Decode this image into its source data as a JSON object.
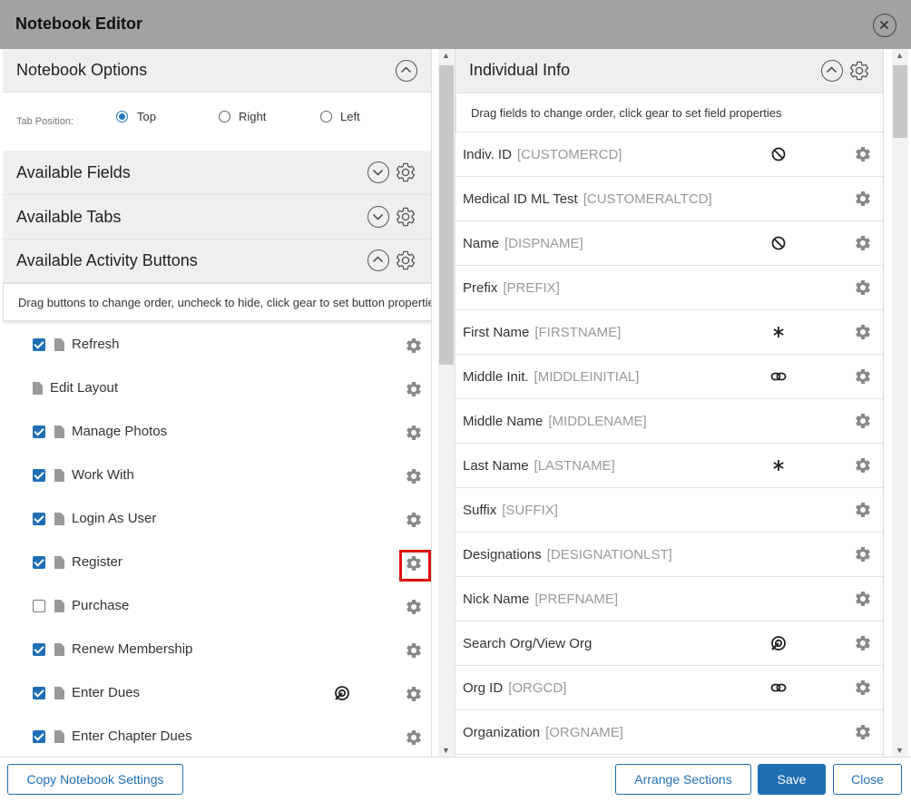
{
  "dialog": {
    "title": "Notebook Editor"
  },
  "left": {
    "notebook_options": {
      "label": "Notebook Options"
    },
    "tab_position": {
      "label": "Tab Position:",
      "options": [
        "Top",
        "Right",
        "Left"
      ],
      "selected": "Top"
    },
    "available_fields": {
      "label": "Available Fields"
    },
    "available_tabs": {
      "label": "Available Tabs"
    },
    "available_activity_buttons": {
      "label": "Available Activity Buttons",
      "hint": "Drag buttons to change order, uncheck to hide, click gear to set button properties",
      "items": [
        {
          "label": "Refresh",
          "checked": true
        },
        {
          "label": "Edit Layout",
          "checked": null
        },
        {
          "label": "Manage Photos",
          "checked": true
        },
        {
          "label": "Work With",
          "checked": true
        },
        {
          "label": "Login As User",
          "checked": true
        },
        {
          "label": "Register",
          "checked": true,
          "highlighted": true
        },
        {
          "label": "Purchase",
          "checked": false
        },
        {
          "label": "Renew Membership",
          "checked": true
        },
        {
          "label": "Enter Dues",
          "checked": true,
          "icon": "target-icon"
        },
        {
          "label": "Enter Chapter Dues",
          "checked": true
        }
      ]
    }
  },
  "right": {
    "section": {
      "label": "Individual Info"
    },
    "hint": "Drag fields to change order, click gear to set field properties",
    "fields": [
      {
        "name": "Indiv. ID",
        "code": "[CUSTOMERCD]",
        "icon": "no-entry-icon"
      },
      {
        "name": "Medical ID ML Test",
        "code": "[CUSTOMERALTCD]",
        "icon": ""
      },
      {
        "name": "Name",
        "code": "[DISPNAME]",
        "icon": "no-entry-icon"
      },
      {
        "name": "Prefix",
        "code": "[PREFIX]",
        "icon": ""
      },
      {
        "name": "First Name",
        "code": "[FIRSTNAME]",
        "icon": "asterisk-icon"
      },
      {
        "name": "Middle Init.",
        "code": "[MIDDLEINITIAL]",
        "icon": "link-icon"
      },
      {
        "name": "Middle Name",
        "code": "[MIDDLENAME]",
        "icon": ""
      },
      {
        "name": "Last Name",
        "code": "[LASTNAME]",
        "icon": "asterisk-icon"
      },
      {
        "name": "Suffix",
        "code": "[SUFFIX]",
        "icon": ""
      },
      {
        "name": "Designations",
        "code": "[DESIGNATIONLST]",
        "icon": ""
      },
      {
        "name": "Nick Name",
        "code": "[PREFNAME]",
        "icon": ""
      },
      {
        "name": "Search Org/View Org",
        "code": "",
        "icon": "target-icon"
      },
      {
        "name": "Org ID",
        "code": "[ORGCD]",
        "icon": "link-icon"
      },
      {
        "name": "Organization",
        "code": "[ORGNAME]",
        "icon": ""
      }
    ]
  },
  "footer": {
    "copy_settings": "Copy Notebook Settings",
    "arrange_sections": "Arrange Sections",
    "save": "Save",
    "close": "Close"
  },
  "colors": {
    "accent": "#1f6fb5",
    "header_bg": "#a2a2a2",
    "highlight": "#e01010"
  }
}
